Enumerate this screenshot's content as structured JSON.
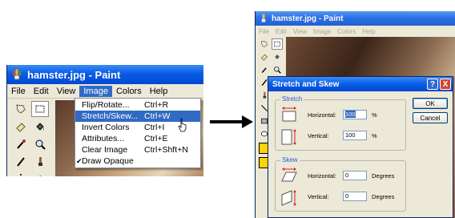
{
  "left_window": {
    "title": "hamster.jpg - Paint",
    "menu": [
      "File",
      "Edit",
      "View",
      "Image",
      "Colors",
      "Help"
    ],
    "active_menu": "Image",
    "dropdown": [
      {
        "label": "Flip/Rotate...",
        "shortcut": "Ctrl+R"
      },
      {
        "label": "Stretch/Skew...",
        "shortcut": "Ctrl+W",
        "highlighted": true
      },
      {
        "label": "Invert Colors",
        "shortcut": "Ctrl+I"
      },
      {
        "label": "Attributes...",
        "shortcut": "Ctrl+E"
      },
      {
        "label": "Clear Image",
        "shortcut": "Ctrl+Shft+N"
      },
      {
        "label": "Draw Opaque",
        "shortcut": "",
        "checked": true
      }
    ],
    "tools": [
      "free-select-icon",
      "rect-select-icon",
      "eraser-icon",
      "fill-icon",
      "picker-icon",
      "magnifier-icon",
      "pencil-icon",
      "brush-icon",
      "airbrush-icon",
      "text-icon"
    ]
  },
  "right_window": {
    "title": "hamster.jpg - Paint",
    "menu": [
      "File",
      "Edit",
      "View",
      "Image",
      "Colors",
      "Help"
    ]
  },
  "dialog": {
    "title": "Stretch and Skew",
    "help_button": "?",
    "close_button": "X",
    "stretch": {
      "title": "Stretch",
      "horizontal_label": "Horizontal:",
      "horizontal_value": "100",
      "horizontal_unit": "%",
      "vertical_label": "Vertical:",
      "vertical_value": "100",
      "vertical_unit": "%"
    },
    "skew": {
      "title": "Skew",
      "horizontal_label": "Horizontal:",
      "horizontal_value": "0",
      "horizontal_unit": "Degrees",
      "vertical_label": "Vertical:",
      "vertical_value": "0",
      "vertical_unit": "Degrees"
    },
    "ok": "OK",
    "cancel": "Cancel"
  },
  "colors": {
    "xp_blue": "#0a5ce6",
    "highlight": "#316ac5",
    "window_bg": "#ece9d8",
    "accent_red": "#e02020"
  }
}
